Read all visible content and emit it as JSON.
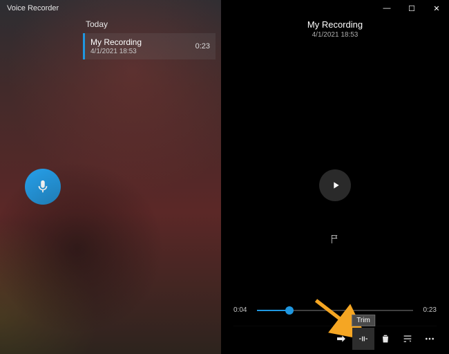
{
  "app": {
    "title": "Voice Recorder"
  },
  "window": {
    "min": "—",
    "max": "☐",
    "close": "✕"
  },
  "list": {
    "section_label": "Today",
    "items": [
      {
        "title": "My Recording",
        "subtitle": "4/1/2021 18:53",
        "duration": "0:23"
      }
    ]
  },
  "detail": {
    "title": "My Recording",
    "subtitle": "4/1/2021 18:53"
  },
  "timeline": {
    "start": "0:04",
    "end": "0:23",
    "progress_pct": 21
  },
  "toolbar": {
    "trim_tooltip": "Trim"
  },
  "icons": {
    "mic": "microphone-icon",
    "play": "play-icon",
    "flag": "flag-icon",
    "share": "share-icon",
    "trim": "trim-icon",
    "delete": "trash-icon",
    "rename": "rename-icon",
    "more": "more-icon"
  },
  "colors": {
    "accent": "#1f97e0"
  }
}
